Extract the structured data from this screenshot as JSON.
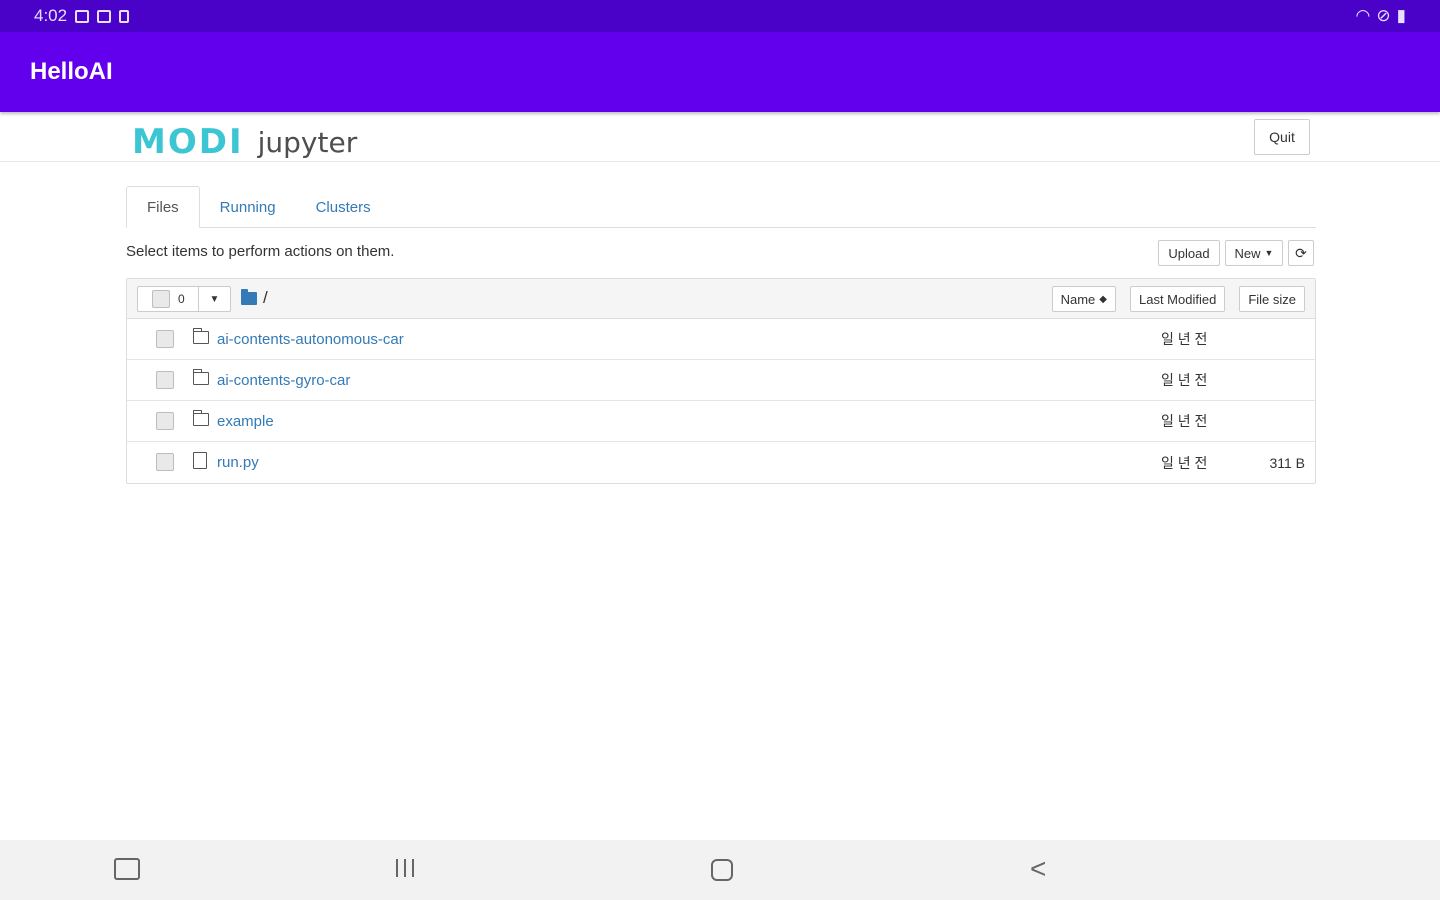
{
  "status": {
    "time": "4:02"
  },
  "app": {
    "title": "HelloAI"
  },
  "header": {
    "logo_brand": "MODI",
    "logo_product": "jupyter",
    "quit_label": "Quit"
  },
  "tabs": [
    {
      "label": "Files",
      "active": true
    },
    {
      "label": "Running",
      "active": false
    },
    {
      "label": "Clusters",
      "active": false
    }
  ],
  "toolbar": {
    "hint": "Select items to perform actions on them.",
    "upload_label": "Upload",
    "new_label": "New",
    "refresh_icon": "refresh-icon"
  },
  "list": {
    "selected_count": "0",
    "breadcrumb": "/",
    "columns": {
      "name": "Name",
      "modified": "Last Modified",
      "size": "File size"
    },
    "rows": [
      {
        "type": "folder",
        "name": "ai-contents-autonomous-car",
        "modified": "일 년 전",
        "size": ""
      },
      {
        "type": "folder",
        "name": "ai-contents-gyro-car",
        "modified": "일 년 전",
        "size": ""
      },
      {
        "type": "folder",
        "name": "example",
        "modified": "일 년 전",
        "size": ""
      },
      {
        "type": "file",
        "name": "run.py",
        "modified": "일 년 전",
        "size": "311 B"
      }
    ]
  }
}
